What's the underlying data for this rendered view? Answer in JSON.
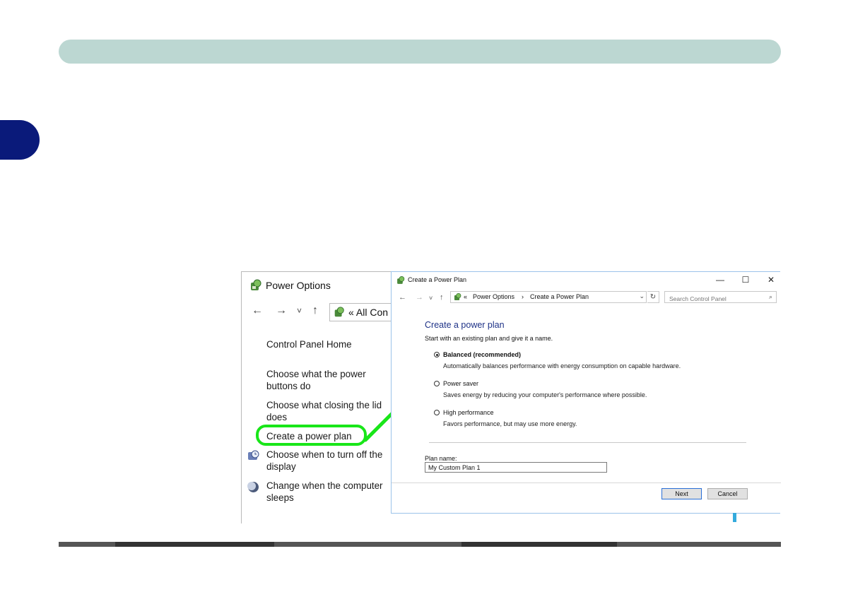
{
  "power_options": {
    "title": "Power Options",
    "nav": {
      "back": "←",
      "forward": "→",
      "recent": "˅",
      "up": "↑"
    },
    "address": "« All Con",
    "links": [
      "Control Panel Home",
      "Choose what the power buttons do",
      "Choose what closing the lid does",
      "Create a power plan",
      "Choose when to turn off the display",
      "Change when the computer sleeps"
    ]
  },
  "create_plan": {
    "title": "Create a Power Plan",
    "window_buttons": {
      "minimize": "—",
      "maximize": "☐",
      "close": "✕"
    },
    "nav": {
      "back": "←",
      "forward": "→",
      "recent": "˅",
      "up": "↑"
    },
    "breadcrumb": {
      "prefix": "«",
      "item1": "Power Options",
      "sep": "›",
      "item2": "Create a Power Plan"
    },
    "search_placeholder": "Search Control Panel",
    "heading": "Create a power plan",
    "subheading": "Start with an existing plan and give it a name.",
    "options": [
      {
        "name": "Balanced (recommended)",
        "desc": "Automatically balances performance with energy consumption on capable hardware.",
        "selected": true
      },
      {
        "name": "Power saver",
        "desc": "Saves energy by reducing your computer's performance where possible.",
        "selected": false
      },
      {
        "name": "High performance",
        "desc": "Favors performance, but may use more energy.",
        "selected": false
      }
    ],
    "plan_name_label": "Plan name:",
    "plan_name_value": "My Custom Plan 1",
    "next_label": "Next",
    "cancel_label": "Cancel"
  },
  "colors": {
    "header_bar": "#bcd7d2",
    "chapter_tab": "#0a1a7a",
    "highlight": "#19e619",
    "heading_blue": "#1e3287"
  }
}
